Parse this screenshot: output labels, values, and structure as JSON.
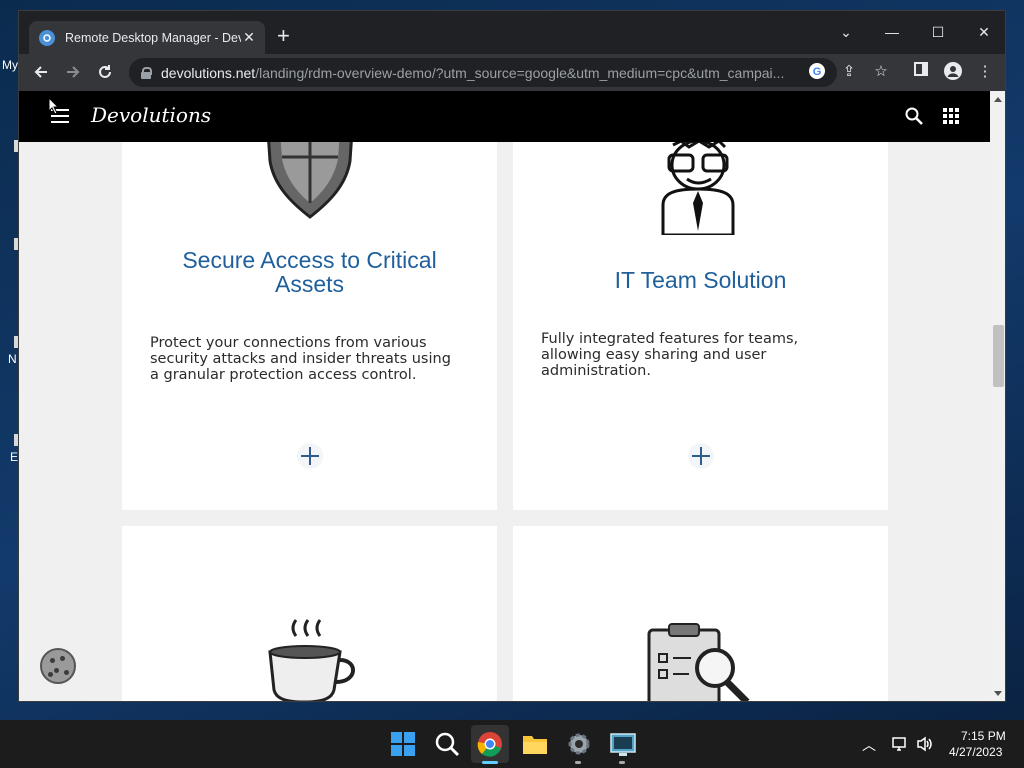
{
  "desktop": {
    "fragments": [
      "My",
      "N",
      "E"
    ]
  },
  "browser": {
    "tab_title": "Remote Desktop Manager - Devo",
    "new_tab_label": "+",
    "url_host": "devolutions.net",
    "url_path": "/landing/rdm-overview-demo/?utm_source=google&utm_medium=cpc&utm_campai..."
  },
  "site": {
    "brand": "Devolutions"
  },
  "cards": [
    {
      "title": "Secure Access to Critical Assets",
      "body": "Protect your connections from various security attacks and insider threats using a granular protection access control."
    },
    {
      "title": "IT Team Solution",
      "body": "Fully integrated features for teams, allowing easy sharing and user administration."
    }
  ],
  "taskbar": {
    "time": "7:15 PM",
    "date": "4/27/2023"
  }
}
